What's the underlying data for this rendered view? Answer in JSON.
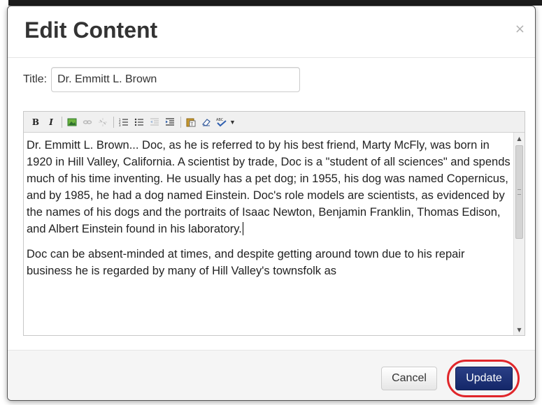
{
  "dialog": {
    "title": "Edit Content",
    "close_symbol": "×"
  },
  "title_field": {
    "label": "Title:",
    "value": "Dr. Emmitt L. Brown"
  },
  "toolbar": {
    "bold": "B",
    "italic": "I",
    "icons": [
      "bold-icon",
      "italic-icon",
      "image-icon",
      "link-icon",
      "unlink-icon",
      "numbered-list-icon",
      "bulleted-list-icon",
      "outdent-icon",
      "indent-icon",
      "paste-text-icon",
      "eraser-icon",
      "spellcheck-icon"
    ]
  },
  "content": {
    "paragraphs": [
      "Dr. Emmitt L. Brown... Doc, as he is referred to by his best friend, Marty McFly, was born in 1920 in Hill Valley, California. A scientist by trade, Doc is a \"student of all sciences\" and spends much of his time inventing. He usually has a pet dog; in 1955, his dog was named Copernicus, and by 1985, he had a dog named Einstein. Doc's role models are scientists, as evidenced by the names of his dogs and the portraits of Isaac Newton, Benjamin Franklin, Thomas Edison, and Albert Einstein found in his laboratory.",
      "Doc can be absent-minded at times, and despite getting around town due to his repair business he is regarded by many of Hill Valley's townsfolk as"
    ]
  },
  "footer": {
    "cancel_label": "Cancel",
    "update_label": "Update"
  },
  "colors": {
    "update_button": "#1b2f73",
    "highlight_ring": "#e0262a"
  }
}
